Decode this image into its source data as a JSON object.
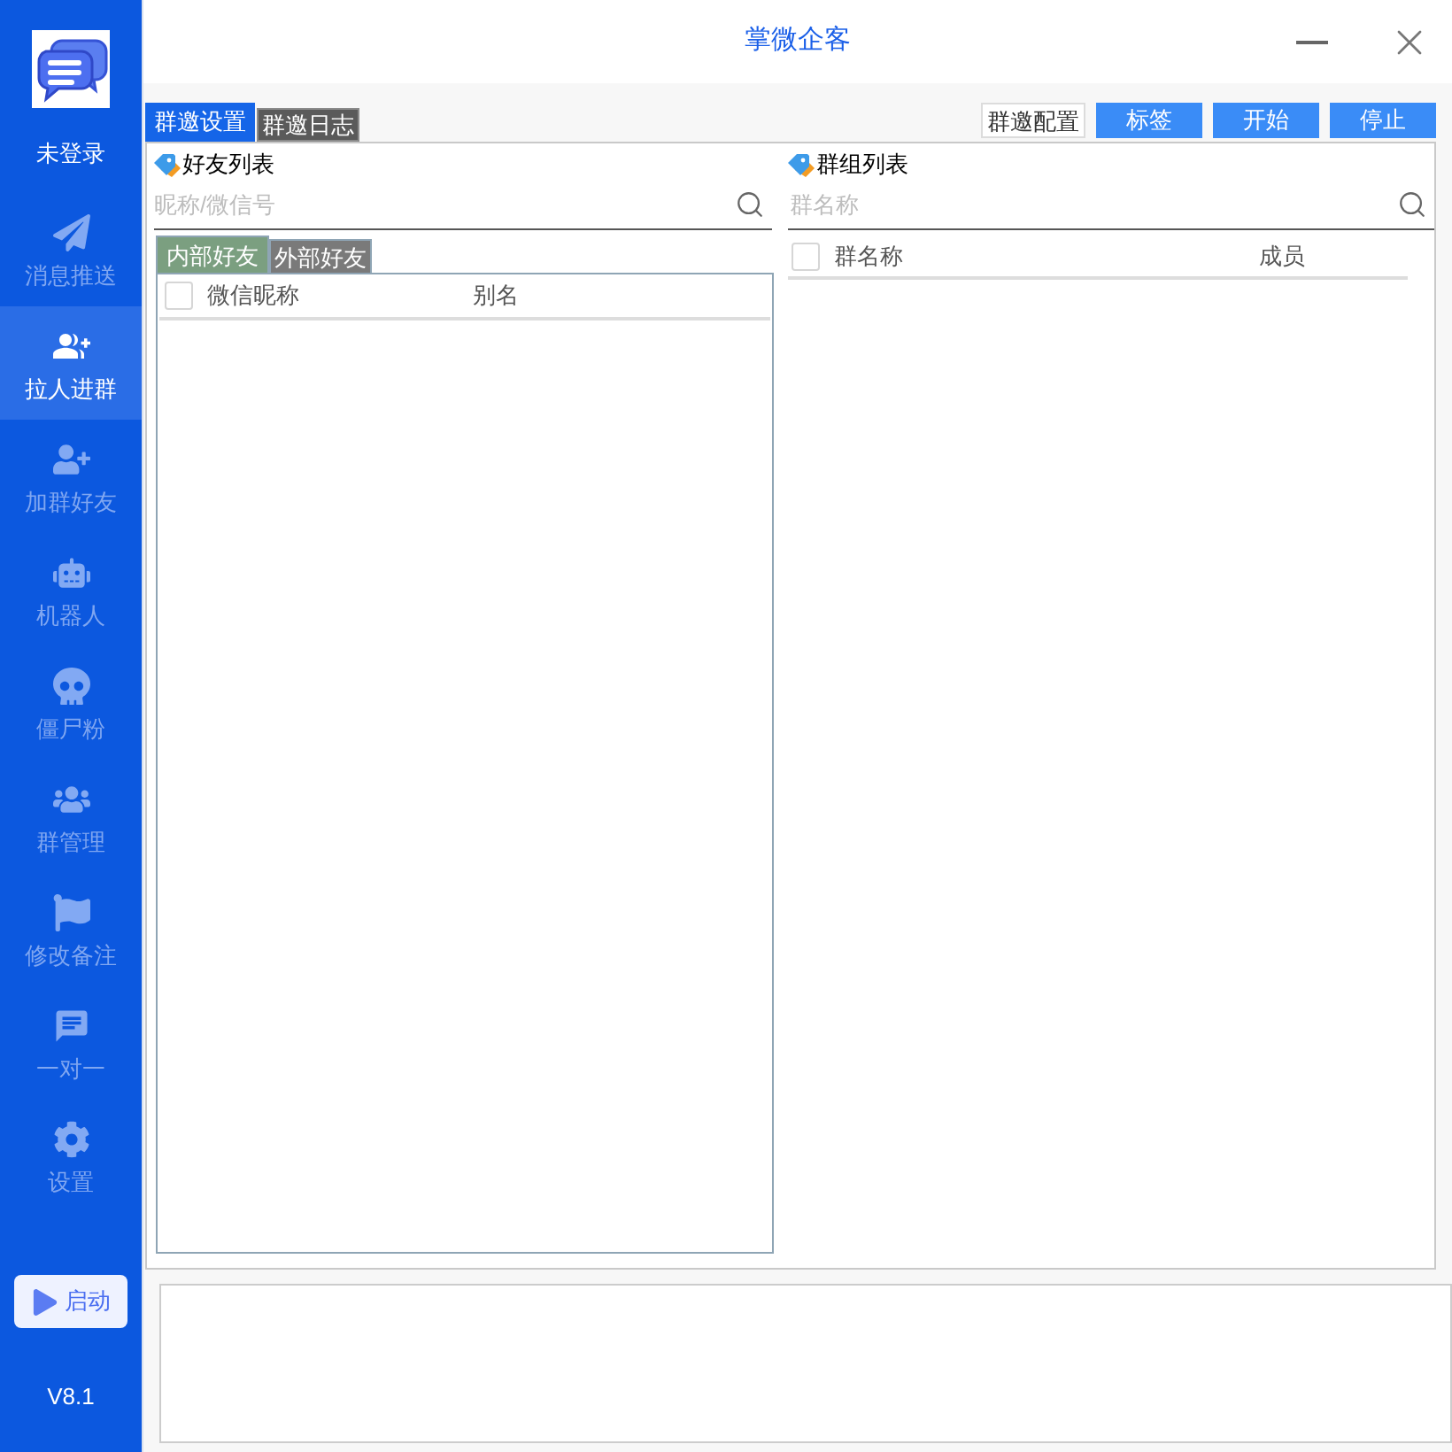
{
  "sidebar": {
    "login_status": "未登录",
    "items": [
      {
        "label": "消息推送",
        "selected": false
      },
      {
        "label": "拉人进群",
        "selected": true
      },
      {
        "label": "加群好友",
        "selected": false
      },
      {
        "label": "机器人",
        "selected": false
      },
      {
        "label": "僵尸粉",
        "selected": false
      },
      {
        "label": "群管理",
        "selected": false
      },
      {
        "label": "修改备注",
        "selected": false
      },
      {
        "label": "一对一",
        "selected": false
      },
      {
        "label": "设置",
        "selected": false
      }
    ],
    "start_button": "启动",
    "version": "V8.1"
  },
  "window": {
    "title": "掌微企客"
  },
  "tabs": [
    {
      "label": "群邀设置",
      "selected": true
    },
    {
      "label": "群邀日志",
      "selected": false
    }
  ],
  "toolbar": [
    {
      "label": "群邀配置",
      "kind": "outline"
    },
    {
      "label": "标签",
      "kind": "primary"
    },
    {
      "label": "开始",
      "kind": "primary"
    },
    {
      "label": "停止",
      "kind": "primary"
    }
  ],
  "friends": {
    "title": "好友列表",
    "search": {
      "placeholder": "昵称/微信号"
    },
    "tabs": [
      {
        "label": "内部好友",
        "selected": true
      },
      {
        "label": "外部好友",
        "selected": false
      }
    ],
    "table": {
      "all_checked": false,
      "columns": [
        "微信昵称",
        "别名"
      ]
    }
  },
  "groups": {
    "title": "群组列表",
    "search": {
      "placeholder": "群名称"
    },
    "table": {
      "all_checked": false,
      "columns": [
        "群名称",
        "成员"
      ]
    }
  }
}
